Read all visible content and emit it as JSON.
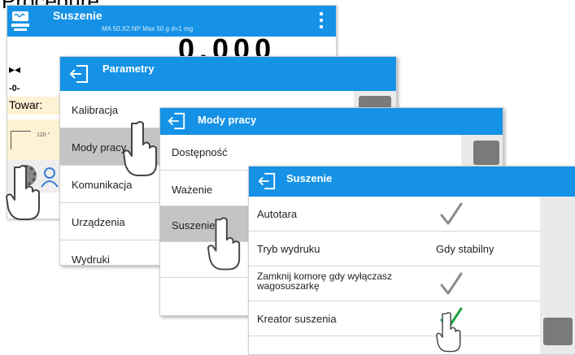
{
  "heading": "Procedure:",
  "base": {
    "title": "Suszenie",
    "subtitle": "MA 50.X2.NP    Max 50 g    d=1 mg",
    "weight": "0.000",
    "stable_marker": "▸◂",
    "zero_marker": "-0-",
    "towar_label": "Towar:",
    "chart_label": "120 °"
  },
  "parametry": {
    "title": "Parametry",
    "items": [
      {
        "label": "Kalibracja"
      },
      {
        "label": "Mody pracy"
      },
      {
        "label": "Komunikacja"
      },
      {
        "label": "Urządzenia"
      },
      {
        "label": "Wydruki"
      }
    ]
  },
  "mody": {
    "title": "Mody pracy",
    "items": [
      {
        "label": "Dostępność"
      },
      {
        "label": "Ważenie"
      },
      {
        "label": "Suszenie"
      },
      {
        "label": ""
      }
    ]
  },
  "suszenie": {
    "title": "Suszenie",
    "rows": [
      {
        "label": "Autotara",
        "value": "",
        "checked": true
      },
      {
        "label": "Tryb wydruku",
        "value": "Gdy stabilny",
        "checked": false
      },
      {
        "label": "Zamknij komorę gdy wyłączasz wagosuszarkę",
        "value": "",
        "checked": true
      },
      {
        "label": "Kreator suszenia",
        "value": "",
        "checked": true
      }
    ]
  },
  "colors": {
    "accent": "#1592e6",
    "selected_row": "#c4c4c4",
    "check_gray": "#8a8a8a",
    "check_green": "#1aa33a"
  }
}
